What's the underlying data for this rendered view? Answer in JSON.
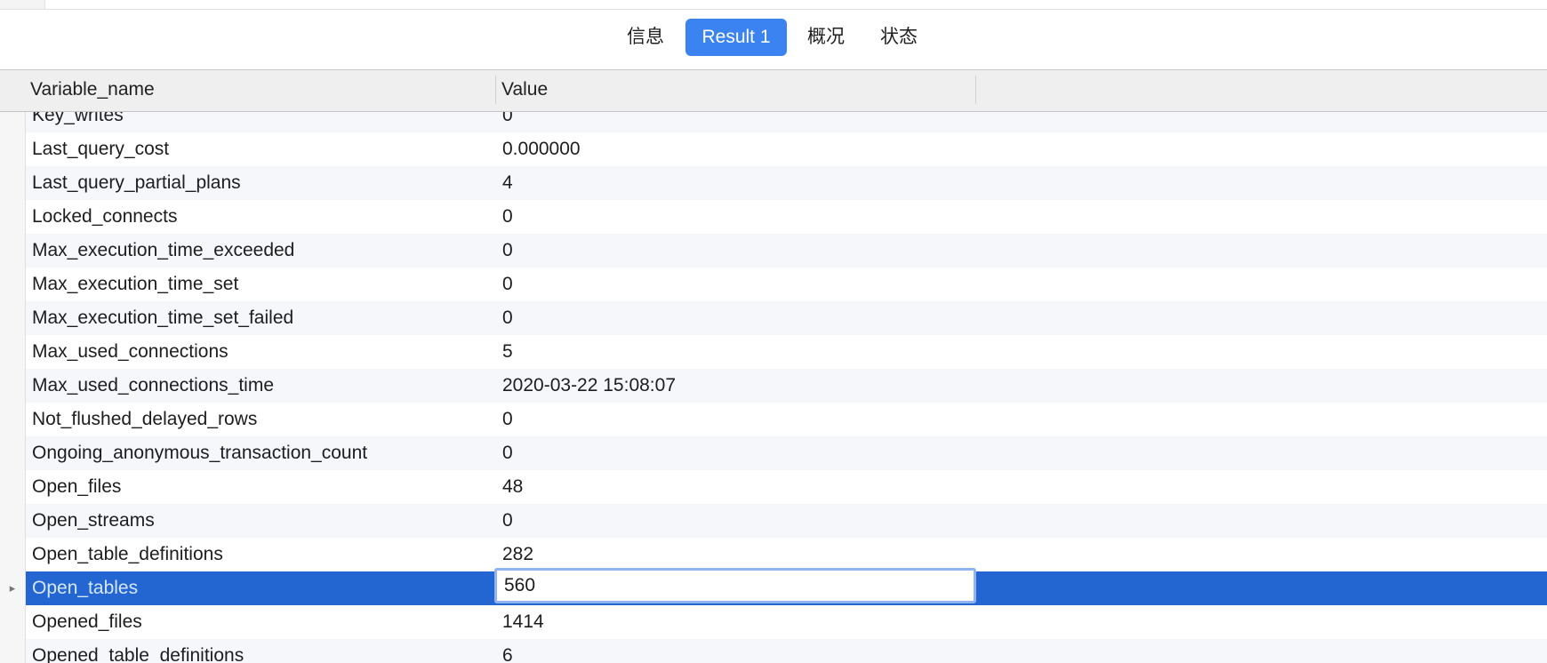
{
  "tabs": [
    {
      "label": "信息",
      "active": false
    },
    {
      "label": "Result 1",
      "active": true
    },
    {
      "label": "概况",
      "active": false
    },
    {
      "label": "状态",
      "active": false
    }
  ],
  "columns": [
    "Variable_name",
    "Value"
  ],
  "rows": [
    {
      "name": "Key_writes",
      "value": "0"
    },
    {
      "name": "Last_query_cost",
      "value": "0.000000"
    },
    {
      "name": "Last_query_partial_plans",
      "value": "4"
    },
    {
      "name": "Locked_connects",
      "value": "0"
    },
    {
      "name": "Max_execution_time_exceeded",
      "value": "0"
    },
    {
      "name": "Max_execution_time_set",
      "value": "0"
    },
    {
      "name": "Max_execution_time_set_failed",
      "value": "0"
    },
    {
      "name": "Max_used_connections",
      "value": "5"
    },
    {
      "name": "Max_used_connections_time",
      "value": "2020-03-22 15:08:07"
    },
    {
      "name": "Not_flushed_delayed_rows",
      "value": "0"
    },
    {
      "name": "Ongoing_anonymous_transaction_count",
      "value": "0"
    },
    {
      "name": "Open_files",
      "value": "48"
    },
    {
      "name": "Open_streams",
      "value": "0"
    },
    {
      "name": "Open_table_definitions",
      "value": "282"
    },
    {
      "name": "Open_tables",
      "value": "560",
      "selected": true
    },
    {
      "name": "Opened_files",
      "value": "1414"
    },
    {
      "name": "Opened_table_definitions",
      "value": "6"
    }
  ],
  "selected_row_marker": "▸",
  "colors": {
    "accent": "#3a83f0",
    "selection": "#2366d1"
  }
}
